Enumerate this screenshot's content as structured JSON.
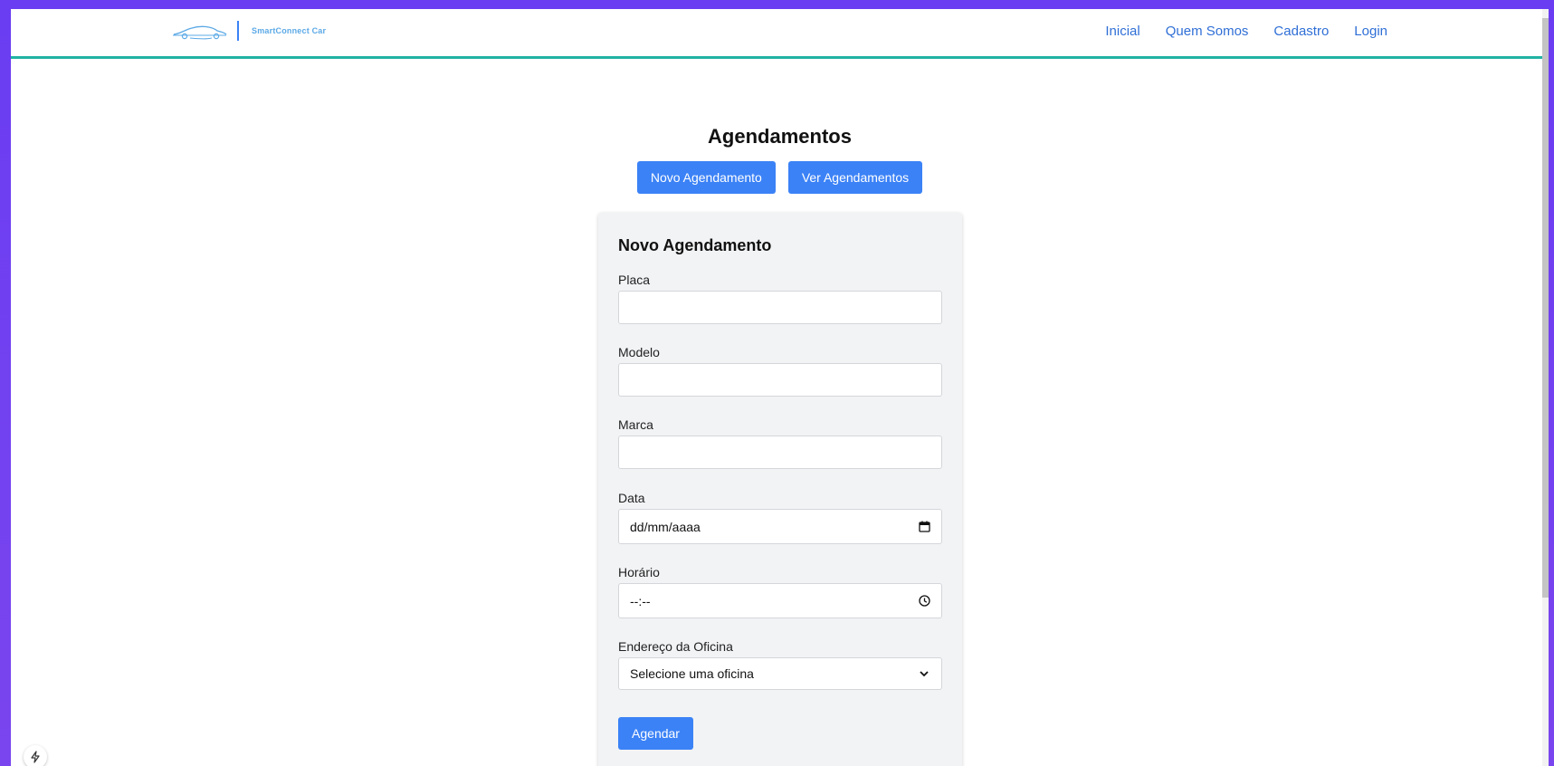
{
  "brand": {
    "name": "SmartConnect Car",
    "accent": "#3b82f6",
    "nav_underline": "#20b3a3"
  },
  "nav": {
    "links": [
      {
        "label": "Inicial"
      },
      {
        "label": "Quem Somos"
      },
      {
        "label": "Cadastro"
      },
      {
        "label": "Login"
      }
    ]
  },
  "main": {
    "title": "Agendamentos",
    "new_button": "Novo Agendamento",
    "view_button": "Ver Agendamentos"
  },
  "form": {
    "title": "Novo Agendamento",
    "placa": {
      "label": "Placa",
      "value": ""
    },
    "modelo": {
      "label": "Modelo",
      "value": ""
    },
    "marca": {
      "label": "Marca",
      "value": ""
    },
    "data": {
      "label": "Data",
      "placeholder": "dd/mm/aaaa",
      "icon": "calendar-icon"
    },
    "horario": {
      "label": "Horário",
      "placeholder": "--:--",
      "icon": "clock-icon"
    },
    "oficina": {
      "label": "Endereço da Oficina",
      "selected": "Selecione uma oficina",
      "icon": "chevron-down-icon"
    },
    "submit": "Agendar"
  },
  "dev_badge": {
    "icon": "lightning-icon"
  }
}
